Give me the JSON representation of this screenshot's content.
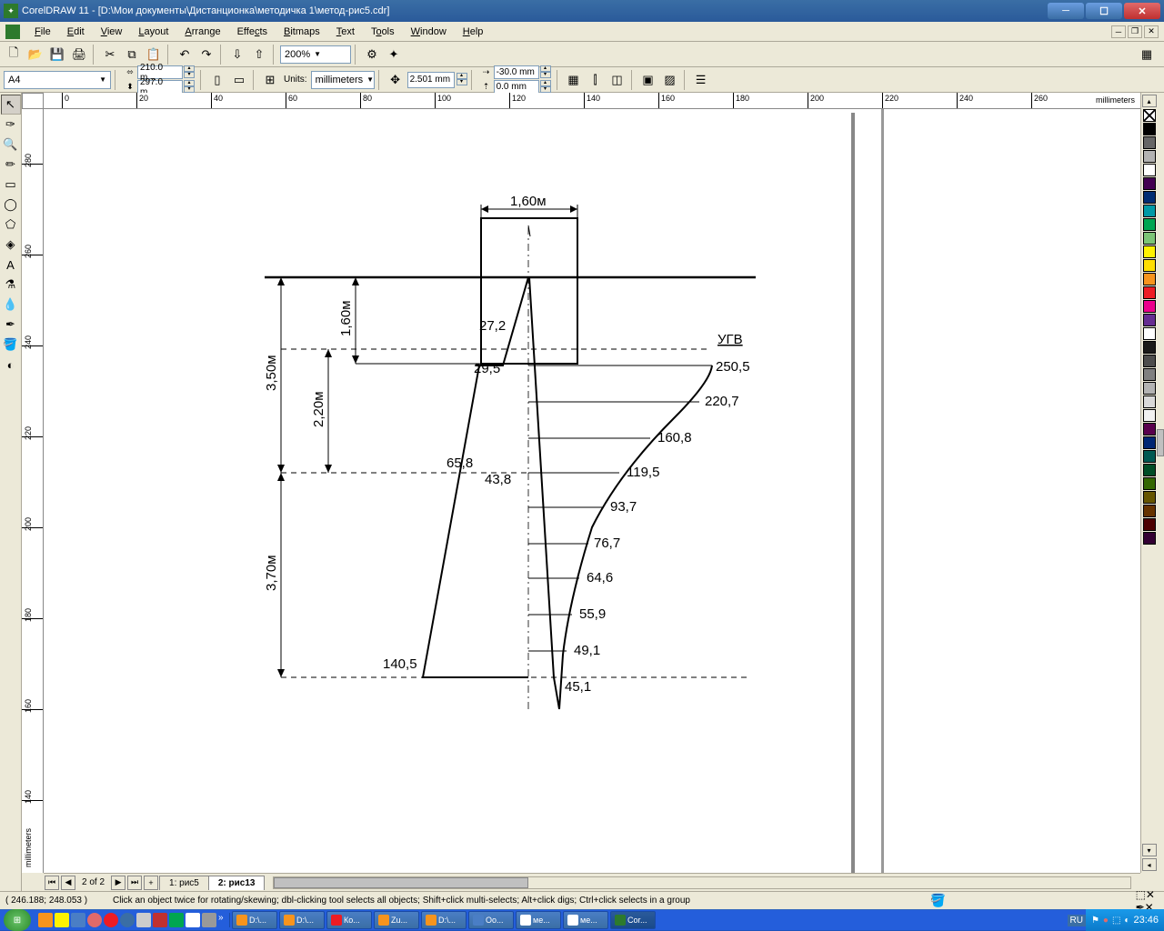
{
  "titlebar": {
    "title": "CorelDRAW 11 - [D:\\Мои документы\\Дистанционка\\методичка 1\\метод-рис5.cdr]"
  },
  "menubar": {
    "items": [
      "File",
      "Edit",
      "View",
      "Layout",
      "Arrange",
      "Effects",
      "Bitmaps",
      "Text",
      "Tools",
      "Window",
      "Help"
    ]
  },
  "toolbar1": {
    "zoom": "200%"
  },
  "propbar": {
    "paper": "A4",
    "width": "210.0 m…",
    "height": "297.0 m…",
    "units_label": "Units:",
    "units": "millimeters",
    "nudge": "2.501 mm",
    "dupx": "-30.0 mm",
    "dupy": "0.0 mm"
  },
  "ruler": {
    "unit": "millimeters",
    "h_ticks": [
      0,
      20,
      40,
      60,
      80,
      100,
      120,
      140,
      160,
      180,
      200,
      220,
      240,
      260
    ],
    "v_ticks": [
      280,
      260,
      240,
      220,
      200,
      180,
      160,
      140
    ]
  },
  "tabs": {
    "page_info": "2 of 2",
    "tabs": [
      "1: рис5",
      "2: рис13"
    ],
    "active": 1
  },
  "status": {
    "coords": "( 246.188; 248.053 )",
    "hint": "Click an object twice for rotating/skewing; dbl-clicking tool selects all objects; Shift+click multi-selects; Alt+click digs; Ctrl+click selects in a group"
  },
  "taskbar": {
    "tasks": [
      "D:\\...",
      "D:\\...",
      "Ко...",
      "Zu...",
      "D:\\...",
      "Oo...",
      "ме...",
      "ме...",
      "Cor..."
    ],
    "lang": "RU",
    "clock": "23:46"
  },
  "drawing": {
    "top_width": "1,60м",
    "depth1": "1,60м",
    "depth_total": "3,50м",
    "depth2": "2,20м",
    "depth3": "3,70м",
    "ugv": "УГВ",
    "left_vals": [
      "27,2",
      "29,5",
      "65,8",
      "43,8",
      "140,5"
    ],
    "right_vals": [
      "250,5",
      "220,7",
      "160,8",
      "119,5",
      "93,7",
      "76,7",
      "64,6",
      "55,9",
      "49,1",
      "45,1"
    ]
  },
  "palette_colors": [
    "#000000",
    "#666666",
    "#b3b3b3",
    "#ffffff",
    "#430052",
    "#002d73",
    "#009aa6",
    "#00a651",
    "#7cc576",
    "#fff200",
    "#ffde00",
    "#f7941d",
    "#ed1c24",
    "#ec008c",
    "#662d91",
    "#ffffff",
    "#1a1a1a",
    "#4d4d4d",
    "#808080",
    "#b3b3b3",
    "#d9d9d9",
    "#f2f2f2",
    "#59004d",
    "#002673",
    "#005952",
    "#004d26",
    "#336600",
    "#665500",
    "#663300",
    "#4d0000",
    "#330033"
  ]
}
